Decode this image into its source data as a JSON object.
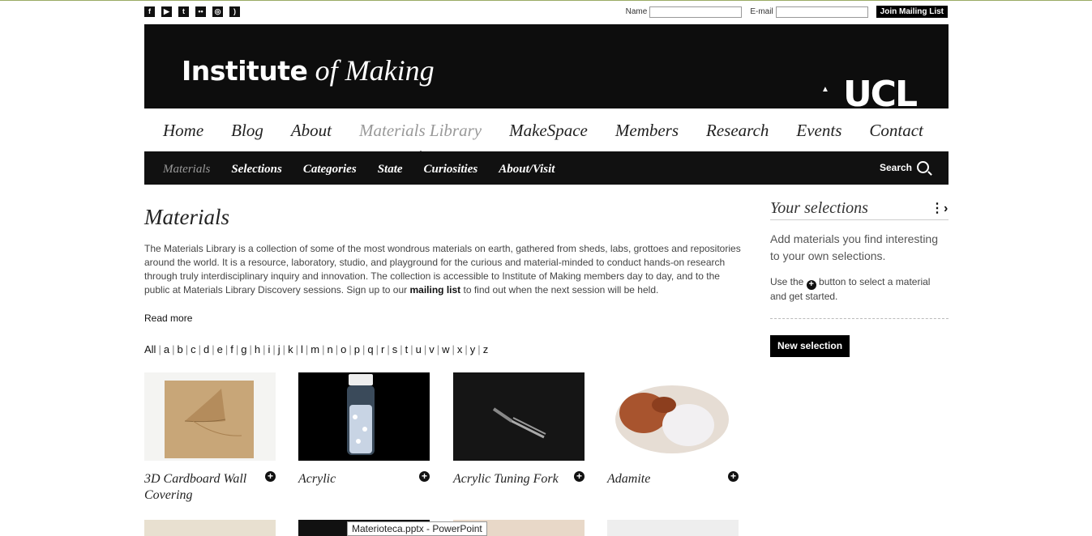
{
  "social": [
    "facebook-icon",
    "youtube-icon",
    "twitter-icon",
    "flickr-icon",
    "instagram-icon",
    "rss-icon"
  ],
  "mailing": {
    "name_label": "Name",
    "email_label": "E-mail",
    "button": "Join Mailing List"
  },
  "banner": {
    "logo_a": "Institute",
    "logo_b": "of Making",
    "ucl": "UCL"
  },
  "mainnav": [
    "Home",
    "Blog",
    "About",
    "Materials Library",
    "MakeSpace",
    "Members",
    "Research",
    "Events",
    "Contact"
  ],
  "subnav": [
    "Materials",
    "Selections",
    "Categories",
    "State",
    "Curiosities",
    "About/Visit"
  ],
  "search_label": "Search",
  "page": {
    "title": "Materials",
    "intro_1": "The Materials Library is a collection of some of the most wondrous materials on earth, gathered from sheds, labs, grottoes and repositories around the world. It is a resource, laboratory, studio, and playground for the curious and material-minded to conduct hands-on research through truly interdisciplinary inquiry and innovation. The collection is accessible to Institute of Making members day to day, and to the public at Materials Library Discovery sessions. Sign up to our ",
    "intro_link": "mailing list",
    "intro_2": " to find out when the next session will be held.",
    "read_more": "Read more",
    "alphabet": [
      "All",
      "a",
      "b",
      "c",
      "d",
      "e",
      "f",
      "g",
      "h",
      "i",
      "j",
      "k",
      "l",
      "m",
      "n",
      "o",
      "p",
      "q",
      "r",
      "s",
      "t",
      "u",
      "v",
      "w",
      "x",
      "y",
      "z"
    ]
  },
  "materials": [
    {
      "title": "3D Cardboard Wall Covering"
    },
    {
      "title": "Acrylic"
    },
    {
      "title": "Acrylic Tuning Fork"
    },
    {
      "title": "Adamite"
    }
  ],
  "sidebar": {
    "title": "Your selections",
    "text": "Add materials you find interesting to your own selections.",
    "hint_a": "Use the",
    "hint_b": "button to select a material and get started.",
    "button": "New selection"
  },
  "tooltip": "Materioteca.pptx - PowerPoint"
}
